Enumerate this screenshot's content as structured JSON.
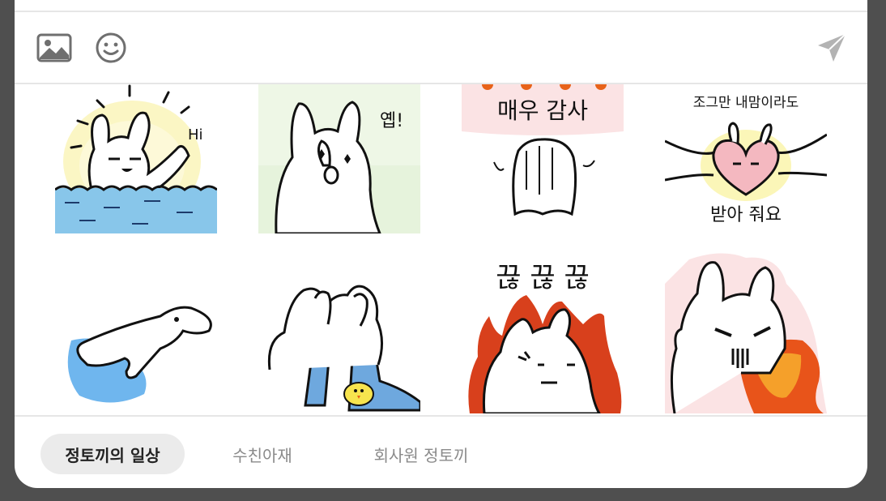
{
  "toolbar": {
    "image_icon": "image-icon",
    "emoji_icon": "emoji-icon",
    "send_icon": "send-icon",
    "icon_color": "#6f6f6f",
    "send_color": "#b3b3b3"
  },
  "stickers": [
    {
      "name": "sticker-hi",
      "text": "Hi"
    },
    {
      "name": "sticker-yep",
      "text": "옙!"
    },
    {
      "name": "sticker-thanks",
      "text": "매우 감사"
    },
    {
      "name": "sticker-heart",
      "text_top": "조그만 내맘이라도",
      "text_bottom": "받아 줘요"
    },
    {
      "name": "sticker-dolphin"
    },
    {
      "name": "sticker-crying"
    },
    {
      "name": "sticker-angry",
      "text": "끊 끊 끊"
    },
    {
      "name": "sticker-fire-breath"
    }
  ],
  "tabs": [
    {
      "label": "정토끼의 일상",
      "active": true
    },
    {
      "label": "수친아재",
      "active": false
    },
    {
      "label": "회사원 정토끼",
      "active": false
    }
  ]
}
